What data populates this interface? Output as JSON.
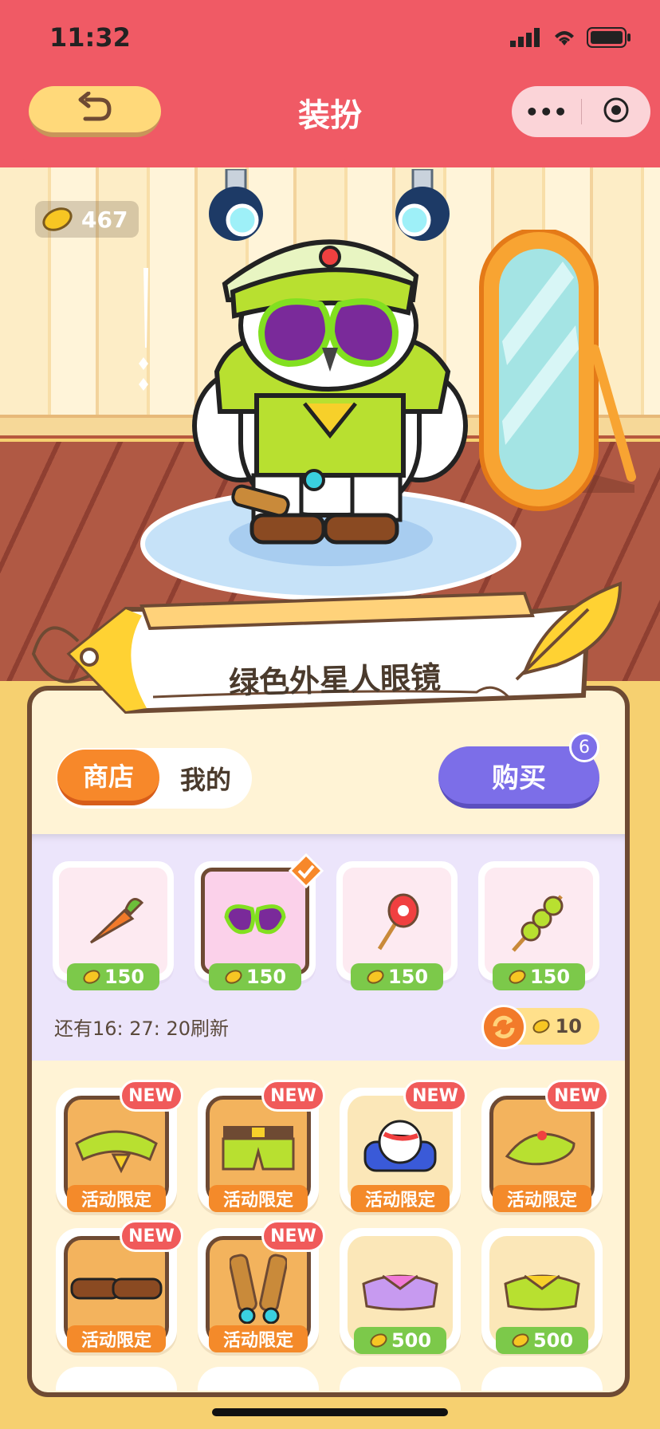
{
  "status": {
    "time": "11:32"
  },
  "nav": {
    "title": "装扮",
    "more_icon": "•••"
  },
  "wallet": {
    "coins": "467"
  },
  "item_name": "绿色外星人眼镜",
  "tabs": {
    "shop": "商店",
    "mine": "我的"
  },
  "buy": {
    "label": "购买",
    "badge": "6"
  },
  "shop_items": [
    {
      "name": "carrot",
      "price": "150"
    },
    {
      "name": "alien-glasses",
      "price": "150",
      "selected": true
    },
    {
      "name": "candied-fruit",
      "price": "150"
    },
    {
      "name": "green-skewer",
      "price": "150"
    }
  ],
  "refresh": {
    "countdown": "还有16: 27: 20刷新",
    "cost": "10"
  },
  "grid_items": [
    {
      "name": "green-scarf",
      "tag": "NEW",
      "label": "活动限定"
    },
    {
      "name": "green-shorts",
      "tag": "NEW",
      "label": "活动限定"
    },
    {
      "name": "alarm-clock",
      "tag": "NEW",
      "label": "活动限定"
    },
    {
      "name": "green-cap",
      "tag": "NEW",
      "label": "活动限定"
    },
    {
      "name": "brown-shoes",
      "tag": "NEW",
      "label": "活动限定"
    },
    {
      "name": "binoculars",
      "tag": "NEW",
      "label": "活动限定"
    },
    {
      "name": "purple-shirt",
      "price": "500"
    },
    {
      "name": "green-shirt",
      "price": "500"
    }
  ],
  "colors": {
    "header": "#f05a65",
    "accent_orange": "#f7882a",
    "buy_purple": "#7c6ee8",
    "price_green": "#7cc94a",
    "new_red": "#f05a5a"
  }
}
